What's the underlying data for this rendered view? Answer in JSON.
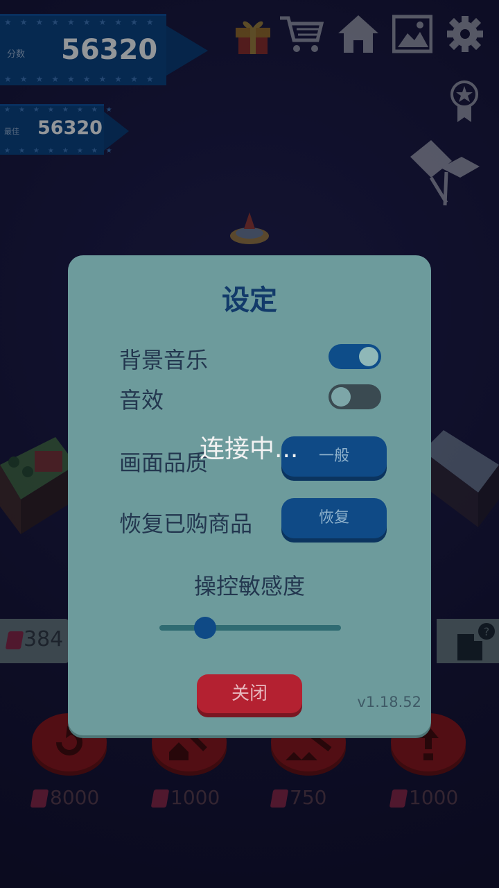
{
  "hud": {
    "score_label": "分数",
    "score_value": "56320",
    "best_label": "最佳",
    "best_value": "56320",
    "icons": [
      "gift-icon",
      "cart-icon",
      "home-icon",
      "gallery-icon",
      "settings-icon"
    ]
  },
  "bottom_bar": {
    "gems_left": "384",
    "prices": [
      "8000",
      "1000",
      "750",
      "1000"
    ]
  },
  "dialog": {
    "title": "设定",
    "bgm_label": "背景音乐",
    "bgm_on": true,
    "sfx_label": "音效",
    "sfx_on": false,
    "quality_label": "画面品质",
    "quality_value": "一般",
    "restore_label": "恢复已购商品",
    "restore_button": "恢复",
    "sensitivity_label": "操控敏感度",
    "sensitivity_value": 0.25,
    "close_button": "关闭",
    "version": "v1.18.52"
  },
  "status": {
    "connecting": "连接中..."
  },
  "colors": {
    "dialog_bg": "#6d9b9c",
    "primary_button": "#0f4a86",
    "close_button": "#b42131",
    "title": "#123a6a"
  }
}
